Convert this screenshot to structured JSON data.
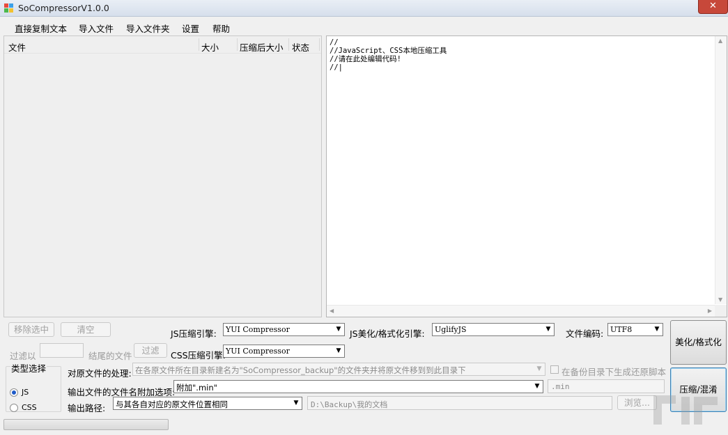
{
  "window": {
    "title": "SoCompressorV1.0.0",
    "close_glyph": "✕"
  },
  "menu": [
    {
      "label": "直接复制文本"
    },
    {
      "label": "导入文件"
    },
    {
      "label": "导入文件夹"
    },
    {
      "label": "设置"
    },
    {
      "label": "帮助"
    }
  ],
  "file_list": {
    "columns": [
      "文件",
      "大小",
      "压缩后大小",
      "状态"
    ],
    "rows": []
  },
  "editor": {
    "text": "//\n//JavaScript、CSS本地压缩工具\n//请在此处编辑代码!\n//|"
  },
  "controls": {
    "remove_selected": "移除选中",
    "clear": "清空",
    "filter_prefix": "过滤以",
    "filter_value": "",
    "filter_suffix": "结尾的文件",
    "filter_button": "过滤",
    "type_group": "类型选择",
    "type_js": "JS",
    "type_css": "CSS",
    "type_selected": "JS",
    "js_engine_label": "JS压缩引擎:",
    "js_engine_value": "YUI Compressor",
    "css_engine_label": "CSS压缩引擎:",
    "css_engine_value": "YUI Compressor",
    "beautify_engine_label": "JS美化/格式化引擎:",
    "beautify_engine_value": "UglifyJS",
    "encoding_label": "文件编码:",
    "encoding_value": "UTF8",
    "source_handling_label": "对原文件的处理:",
    "source_handling_value": "在各原文件所在目录新建名为\"SoCompressor_backup\"的文件夹并将原文件移到到此目录下",
    "restore_script_label": "在备份目录下生成还原脚本",
    "restore_script_checked": false,
    "suffix_label": "输出文件的文件名附加选项:",
    "suffix_value": "附加\".min\"",
    "suffix_text": ".min",
    "output_path_label": "输出路径:",
    "output_path_option": "与其各自对应的原文件位置相同",
    "output_path_value": "D:\\Backup\\我的文档",
    "browse": "浏览...",
    "beautify_button": "美化/格式化",
    "compress_button": "压缩/混淆"
  },
  "colors": {
    "accent": "#1e5ac8",
    "close": "#c7483a"
  }
}
